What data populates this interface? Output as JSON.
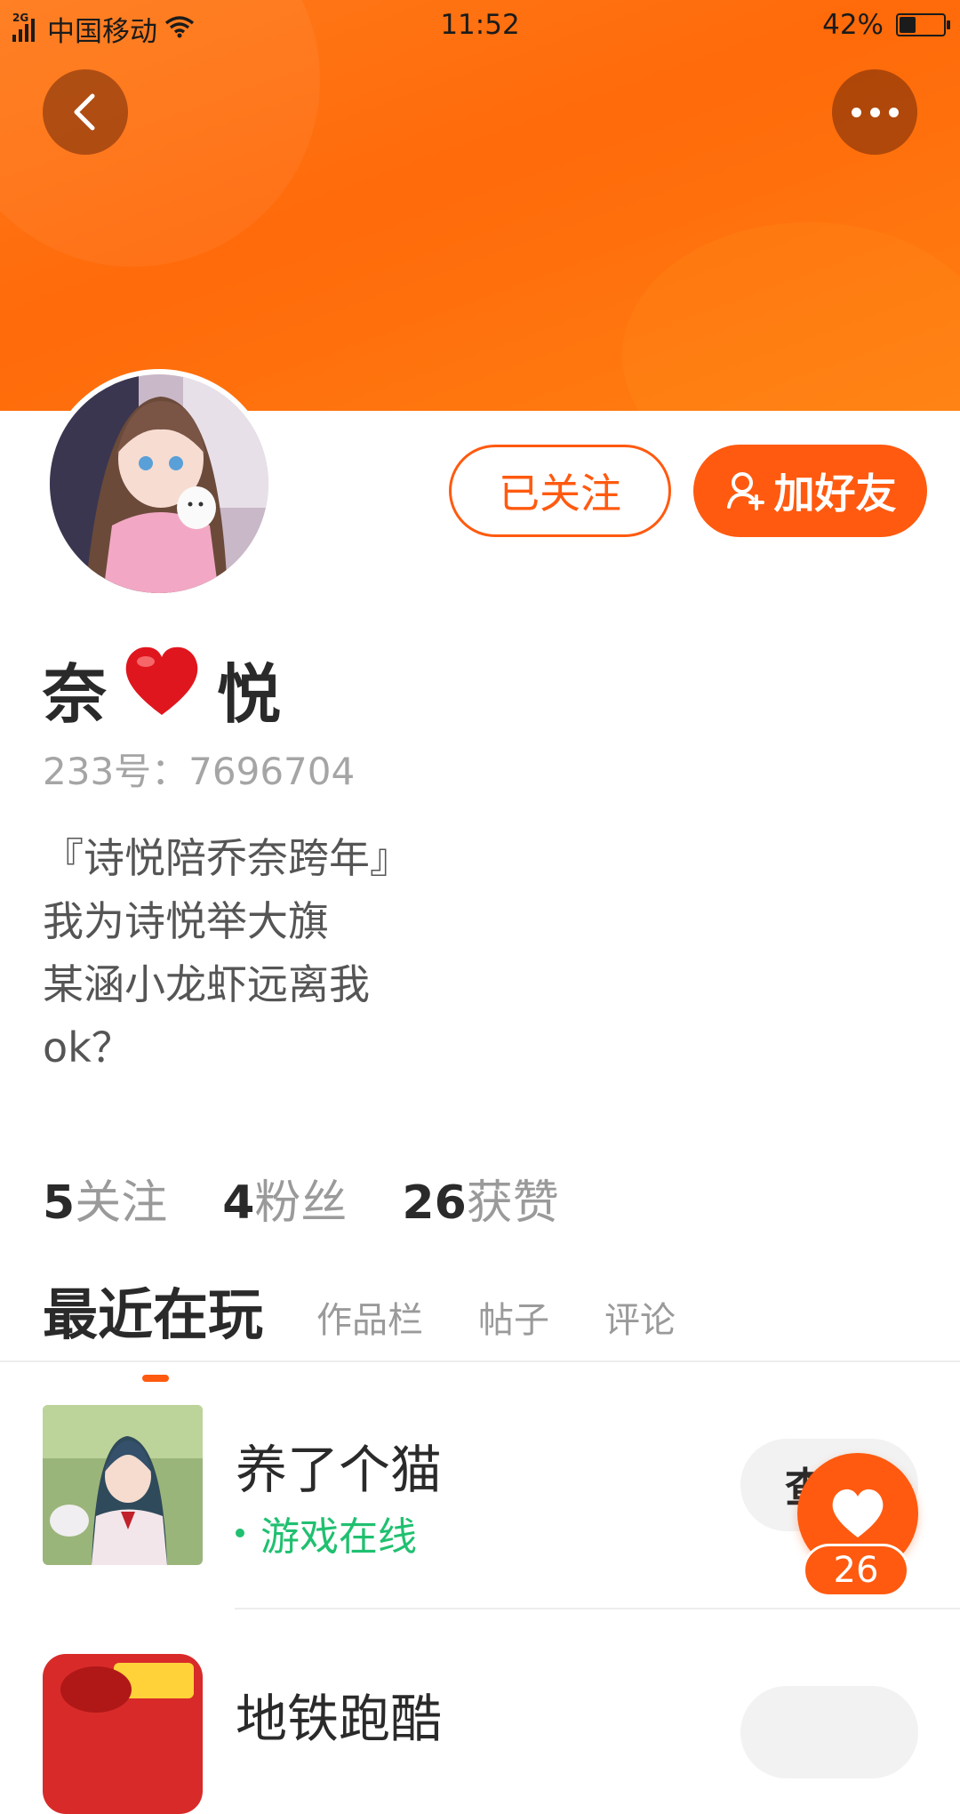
{
  "status_bar": {
    "network": "2G",
    "carrier": "中国移动",
    "time": "11:52",
    "battery": "42%",
    "battery_level": 0.42
  },
  "header": {
    "back_icon": "chevron-left-icon",
    "more_icon": "more-dots-icon"
  },
  "profile": {
    "name_part1": "奈",
    "name_emoji": "❤️",
    "name_part2": "悦",
    "uid_label": "233号：",
    "uid_value": "7696704",
    "bio_lines": [
      "『诗悦陪乔奈跨年』",
      "我为诗悦举大旗",
      "某涵小龙虾远离我",
      "ok？"
    ],
    "followed_label": "已关注",
    "add_friend_label": "加好友"
  },
  "stats": [
    {
      "value": "5",
      "label": "关注"
    },
    {
      "value": "4",
      "label": "粉丝"
    },
    {
      "value": "26",
      "label": "获赞"
    }
  ],
  "tabs": [
    "最近在玩",
    "作品栏",
    "帖子",
    "评论"
  ],
  "games": [
    {
      "title": "养了个猫",
      "status": "游戏在线",
      "button": "查"
    },
    {
      "title": "地铁跑酷"
    }
  ],
  "fab": {
    "count": "26",
    "icon": "heart-icon"
  },
  "colors": {
    "accent": "#ff5a10",
    "online": "#20c070"
  }
}
